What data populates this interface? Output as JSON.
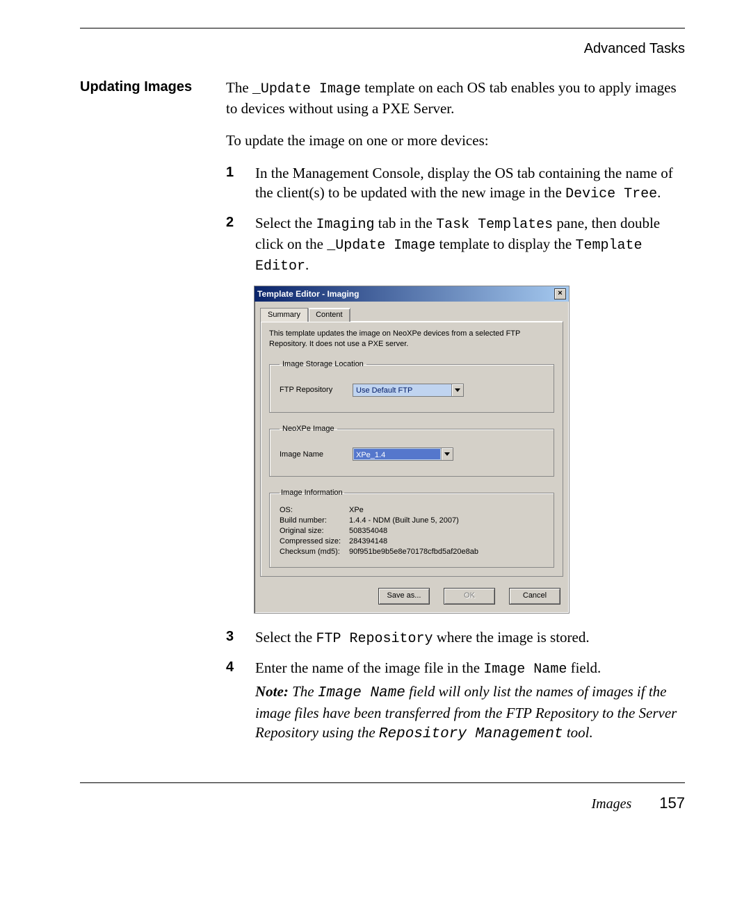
{
  "header": "Advanced Tasks",
  "section_heading": "Updating Images",
  "intro": {
    "p1_a": "The ",
    "p1_b": "_Update Image",
    "p1_c": " template on each OS tab enables you to apply images to devices without using a PXE Server.",
    "p2": "To update the image on one or more devices:"
  },
  "steps": {
    "s1": {
      "num": "1",
      "a": "In the Management Console, display the OS tab containing the name of the client(s) to be updated with the new image in the ",
      "b": "Device Tree",
      "c": "."
    },
    "s2": {
      "num": "2",
      "a": "Select the ",
      "b": "Imaging",
      "c": " tab in the ",
      "d": "Task Templates",
      "e": " pane, then double click on the ",
      "f": "_Update Image",
      "g": " template to display the ",
      "h": "Template Editor",
      "i": "."
    },
    "s3": {
      "num": "3",
      "a": "Select the ",
      "b": "FTP Repository",
      "c": " where the image is stored."
    },
    "s4": {
      "num": "4",
      "a": "Enter the name of the image file in the ",
      "b": "Image Name",
      "c": " field."
    }
  },
  "note": {
    "lead": "Note:",
    "a": " The ",
    "b": "Image Name",
    "c": " field will only list the names of images if the image files have been transferred from the FTP Repository to the Server Repository using the ",
    "d": "Repository Management",
    "e": " tool."
  },
  "dialog": {
    "title": "Template Editor - Imaging",
    "close": "×",
    "tabs": {
      "summary": "Summary",
      "content": "Content"
    },
    "desc": "This template updates the image on NeoXPe devices from a selected FTP Repository. It does not use a PXE server.",
    "group1": {
      "legend": "Image Storage Location",
      "label": "FTP Repository",
      "value": "Use Default FTP"
    },
    "group2": {
      "legend": "NeoXPe Image",
      "label": "Image Name",
      "value": "XPe_1.4"
    },
    "group3": {
      "legend": "Image Information",
      "rows": {
        "os": {
          "label": "OS:",
          "value": "XPe"
        },
        "build": {
          "label": "Build number:",
          "value": "1.4.4 - NDM (Built June 5, 2007)"
        },
        "orig": {
          "label": "Original size:",
          "value": "508354048"
        },
        "comp": {
          "label": "Compressed size:",
          "value": "284394148"
        },
        "checksum": {
          "label": "Checksum (md5):",
          "value": "90f951be9b5e8e70178cfbd5af20e8ab"
        }
      }
    },
    "buttons": {
      "saveas": "Save as...",
      "ok": "OK",
      "cancel": "Cancel"
    }
  },
  "footer": {
    "section": "Images",
    "page": "157"
  }
}
